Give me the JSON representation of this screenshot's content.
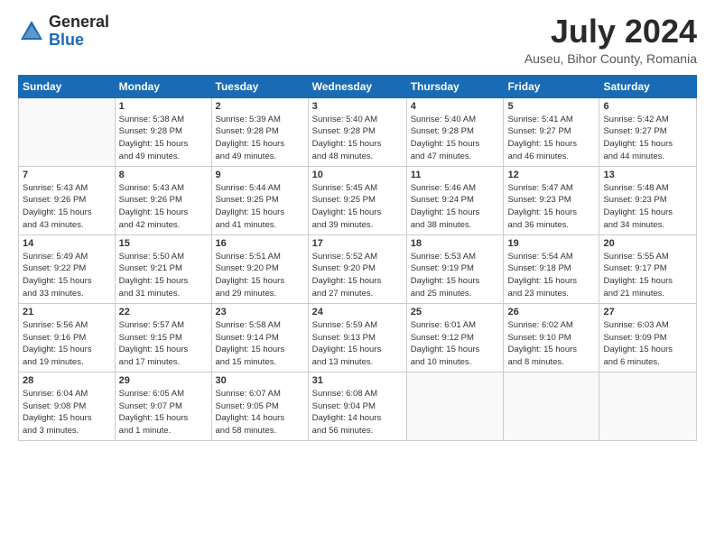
{
  "logo": {
    "general": "General",
    "blue": "Blue"
  },
  "title": "July 2024",
  "subtitle": "Auseu, Bihor County, Romania",
  "days_of_week": [
    "Sunday",
    "Monday",
    "Tuesday",
    "Wednesday",
    "Thursday",
    "Friday",
    "Saturday"
  ],
  "weeks": [
    [
      {
        "day": "",
        "info": ""
      },
      {
        "day": "1",
        "info": "Sunrise: 5:38 AM\nSunset: 9:28 PM\nDaylight: 15 hours\nand 49 minutes."
      },
      {
        "day": "2",
        "info": "Sunrise: 5:39 AM\nSunset: 9:28 PM\nDaylight: 15 hours\nand 49 minutes."
      },
      {
        "day": "3",
        "info": "Sunrise: 5:40 AM\nSunset: 9:28 PM\nDaylight: 15 hours\nand 48 minutes."
      },
      {
        "day": "4",
        "info": "Sunrise: 5:40 AM\nSunset: 9:28 PM\nDaylight: 15 hours\nand 47 minutes."
      },
      {
        "day": "5",
        "info": "Sunrise: 5:41 AM\nSunset: 9:27 PM\nDaylight: 15 hours\nand 46 minutes."
      },
      {
        "day": "6",
        "info": "Sunrise: 5:42 AM\nSunset: 9:27 PM\nDaylight: 15 hours\nand 44 minutes."
      }
    ],
    [
      {
        "day": "7",
        "info": "Sunrise: 5:43 AM\nSunset: 9:26 PM\nDaylight: 15 hours\nand 43 minutes."
      },
      {
        "day": "8",
        "info": "Sunrise: 5:43 AM\nSunset: 9:26 PM\nDaylight: 15 hours\nand 42 minutes."
      },
      {
        "day": "9",
        "info": "Sunrise: 5:44 AM\nSunset: 9:25 PM\nDaylight: 15 hours\nand 41 minutes."
      },
      {
        "day": "10",
        "info": "Sunrise: 5:45 AM\nSunset: 9:25 PM\nDaylight: 15 hours\nand 39 minutes."
      },
      {
        "day": "11",
        "info": "Sunrise: 5:46 AM\nSunset: 9:24 PM\nDaylight: 15 hours\nand 38 minutes."
      },
      {
        "day": "12",
        "info": "Sunrise: 5:47 AM\nSunset: 9:23 PM\nDaylight: 15 hours\nand 36 minutes."
      },
      {
        "day": "13",
        "info": "Sunrise: 5:48 AM\nSunset: 9:23 PM\nDaylight: 15 hours\nand 34 minutes."
      }
    ],
    [
      {
        "day": "14",
        "info": "Sunrise: 5:49 AM\nSunset: 9:22 PM\nDaylight: 15 hours\nand 33 minutes."
      },
      {
        "day": "15",
        "info": "Sunrise: 5:50 AM\nSunset: 9:21 PM\nDaylight: 15 hours\nand 31 minutes."
      },
      {
        "day": "16",
        "info": "Sunrise: 5:51 AM\nSunset: 9:20 PM\nDaylight: 15 hours\nand 29 minutes."
      },
      {
        "day": "17",
        "info": "Sunrise: 5:52 AM\nSunset: 9:20 PM\nDaylight: 15 hours\nand 27 minutes."
      },
      {
        "day": "18",
        "info": "Sunrise: 5:53 AM\nSunset: 9:19 PM\nDaylight: 15 hours\nand 25 minutes."
      },
      {
        "day": "19",
        "info": "Sunrise: 5:54 AM\nSunset: 9:18 PM\nDaylight: 15 hours\nand 23 minutes."
      },
      {
        "day": "20",
        "info": "Sunrise: 5:55 AM\nSunset: 9:17 PM\nDaylight: 15 hours\nand 21 minutes."
      }
    ],
    [
      {
        "day": "21",
        "info": "Sunrise: 5:56 AM\nSunset: 9:16 PM\nDaylight: 15 hours\nand 19 minutes."
      },
      {
        "day": "22",
        "info": "Sunrise: 5:57 AM\nSunset: 9:15 PM\nDaylight: 15 hours\nand 17 minutes."
      },
      {
        "day": "23",
        "info": "Sunrise: 5:58 AM\nSunset: 9:14 PM\nDaylight: 15 hours\nand 15 minutes."
      },
      {
        "day": "24",
        "info": "Sunrise: 5:59 AM\nSunset: 9:13 PM\nDaylight: 15 hours\nand 13 minutes."
      },
      {
        "day": "25",
        "info": "Sunrise: 6:01 AM\nSunset: 9:12 PM\nDaylight: 15 hours\nand 10 minutes."
      },
      {
        "day": "26",
        "info": "Sunrise: 6:02 AM\nSunset: 9:10 PM\nDaylight: 15 hours\nand 8 minutes."
      },
      {
        "day": "27",
        "info": "Sunrise: 6:03 AM\nSunset: 9:09 PM\nDaylight: 15 hours\nand 6 minutes."
      }
    ],
    [
      {
        "day": "28",
        "info": "Sunrise: 6:04 AM\nSunset: 9:08 PM\nDaylight: 15 hours\nand 3 minutes."
      },
      {
        "day": "29",
        "info": "Sunrise: 6:05 AM\nSunset: 9:07 PM\nDaylight: 15 hours\nand 1 minute."
      },
      {
        "day": "30",
        "info": "Sunrise: 6:07 AM\nSunset: 9:05 PM\nDaylight: 14 hours\nand 58 minutes."
      },
      {
        "day": "31",
        "info": "Sunrise: 6:08 AM\nSunset: 9:04 PM\nDaylight: 14 hours\nand 56 minutes."
      },
      {
        "day": "",
        "info": ""
      },
      {
        "day": "",
        "info": ""
      },
      {
        "day": "",
        "info": ""
      }
    ]
  ]
}
